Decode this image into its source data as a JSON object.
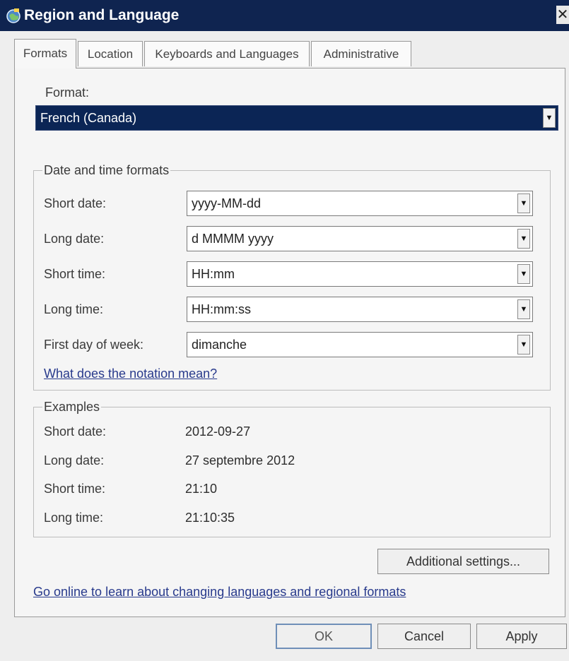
{
  "window": {
    "title": "Region and Language",
    "close_glyph": "✕"
  },
  "tabs": [
    {
      "label": "Formats",
      "active": true
    },
    {
      "label": "Location",
      "active": false
    },
    {
      "label": "Keyboards and Languages",
      "active": false
    },
    {
      "label": "Administrative",
      "active": false
    }
  ],
  "format": {
    "label": "Format:",
    "value": "French (Canada)"
  },
  "datetime": {
    "legend": "Date and time formats",
    "short_date": {
      "label": "Short date:",
      "value": "yyyy-MM-dd"
    },
    "long_date": {
      "label": "Long date:",
      "value": "d MMMM yyyy"
    },
    "short_time": {
      "label": "Short time:",
      "value": "HH:mm"
    },
    "long_time": {
      "label": "Long time:",
      "value": "HH:mm:ss"
    },
    "first_day": {
      "label": "First day of week:",
      "value": "dimanche"
    },
    "notation_link": "What does the notation mean?"
  },
  "examples": {
    "legend": "Examples",
    "short_date": {
      "label": "Short date:",
      "value": "2012-09-27"
    },
    "long_date": {
      "label": "Long date:",
      "value": "27 septembre 2012"
    },
    "short_time": {
      "label": "Short time:",
      "value": "21:10"
    },
    "long_time": {
      "label": "Long time:",
      "value": "21:10:35"
    }
  },
  "additional_settings_label": "Additional settings...",
  "online_link": "Go online to learn about changing languages and regional formats",
  "buttons": {
    "ok": "OK",
    "cancel": "Cancel",
    "apply": "Apply"
  },
  "colors": {
    "titlebar": "#0f2450",
    "selection": "#0b2555",
    "link": "#283a8c"
  },
  "icons": {
    "title": "globe-icon",
    "dropdown": "chevron-down-icon"
  }
}
